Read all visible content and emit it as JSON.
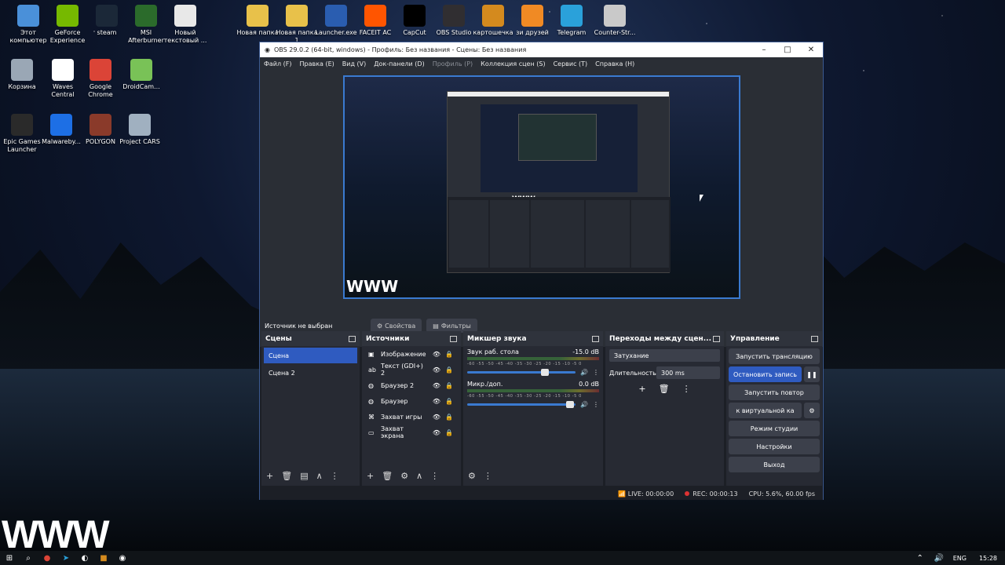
{
  "desktop_icons": [
    {
      "label": "Этот компьютер",
      "icon": "computer-icon",
      "color": "#4a90d9"
    },
    {
      "label": "GeForce Experience",
      "icon": "nvidia-icon",
      "color": "#76b900"
    },
    {
      "label": "steam",
      "icon": "steam-icon",
      "color": "#1b2838"
    },
    {
      "label": "MSI Afterburner",
      "icon": "afterburner-icon",
      "color": "#2b6b2b"
    },
    {
      "label": "Новый текстовый ...",
      "icon": "text-file-icon",
      "color": "#e8e8e8"
    },
    {
      "label": "Новая папка",
      "icon": "folder-icon",
      "color": "#e8c14a"
    },
    {
      "label": "Новая папка 1",
      "icon": "folder-icon",
      "color": "#e8c14a"
    },
    {
      "label": "Launcher.exe",
      "icon": "launcher-icon",
      "color": "#2a5db0"
    },
    {
      "label": "FACEIT AC",
      "icon": "faceit-icon",
      "color": "#ff5500"
    },
    {
      "label": "CapCut",
      "icon": "capcut-icon",
      "color": "#000000"
    },
    {
      "label": "OBS Studio",
      "icon": "obs-icon",
      "color": "#302e31"
    },
    {
      "label": "картошечка",
      "icon": "csgo-icon",
      "color": "#d48a1e"
    },
    {
      "label": "зи друзей",
      "icon": "fl-studio-icon",
      "color": "#f08a24"
    },
    {
      "label": "Telegram",
      "icon": "telegram-icon",
      "color": "#2aa1da"
    },
    {
      "label": "Counter-Str...",
      "icon": "cs-icon",
      "color": "#c9c9c9"
    },
    {
      "label": "Корзина",
      "icon": "recycle-bin-icon",
      "color": "#9aa7b5"
    },
    {
      "label": "Waves Central",
      "icon": "waves-icon",
      "color": "#ffffff"
    },
    {
      "label": "Google Chrome",
      "icon": "chrome-icon",
      "color": "#db4437"
    },
    {
      "label": "DroidCam...",
      "icon": "droidcam-icon",
      "color": "#79c257"
    },
    {
      "label": "Epic Games Launcher",
      "icon": "epic-icon",
      "color": "#2a2a2a"
    },
    {
      "label": "Malwareby...",
      "icon": "malwarebytes-icon",
      "color": "#1d6fe5"
    },
    {
      "label": "POLYGON",
      "icon": "polygon-icon",
      "color": "#8a3a2a"
    },
    {
      "label": "Project CARS",
      "icon": "project-cars-icon",
      "color": "#a0b0c0"
    }
  ],
  "watermark": "WWW",
  "preview_watermark": "WWW",
  "window": {
    "title": "OBS 29.0.2 (64-bit, windows) - Профиль: Без названия - Сцены: Без названия",
    "minimize": "–",
    "maximize": "□",
    "close": "✕"
  },
  "menu": [
    "Файл (F)",
    "Правка (E)",
    "Вид (V)",
    "Док-панели (D)",
    "Профиль (P)",
    "Коллекция сцен (S)",
    "Сервис (T)",
    "Справка (H)"
  ],
  "source_bar": {
    "status": "Источник не выбран",
    "properties": "Свойства",
    "filters": "Фильтры"
  },
  "scenes": {
    "title": "Сцены",
    "items": [
      "Сцена",
      "Сцена 2"
    ]
  },
  "sources": {
    "title": "Источники",
    "items": [
      {
        "name": "Изображение",
        "icon": "image-icon"
      },
      {
        "name": "Текст (GDI+) 2",
        "icon": "text-icon"
      },
      {
        "name": "Браузер 2",
        "icon": "globe-icon"
      },
      {
        "name": "Браузер",
        "icon": "globe-icon"
      },
      {
        "name": "Захват игры",
        "icon": "gamepad-icon"
      },
      {
        "name": "Захват экрана",
        "icon": "monitor-icon"
      }
    ]
  },
  "mixer": {
    "title": "Микшер звука",
    "ticks": "-60 -55 -50 -45 -40 -35 -30 -25 -20 -15 -10 -5 0",
    "channels": [
      {
        "name": "Звук раб. стола",
        "db": "-15.0 dB",
        "level": 0.72
      },
      {
        "name": "Микр./доп.",
        "db": "0.0 dB",
        "level": 0.95
      }
    ]
  },
  "transitions": {
    "title": "Переходы между сцен...",
    "type": "Затухание",
    "duration_label": "Длительность",
    "duration": "300 ms"
  },
  "controls": {
    "title": "Управление",
    "start_stream": "Запустить трансляцию",
    "stop_record": "Остановить запись",
    "replay": "Запустить повтор",
    "virtual_cam": "к виртуальной ка",
    "studio": "Режим студии",
    "settings": "Настройки",
    "exit": "Выход"
  },
  "status": {
    "live": "LIVE: 00:00:00",
    "rec": "REC: 00:00:13",
    "cpu": "CPU: 5.6%, 60.00 fps"
  },
  "tray": {
    "lang": "ENG",
    "time": "15:28"
  }
}
